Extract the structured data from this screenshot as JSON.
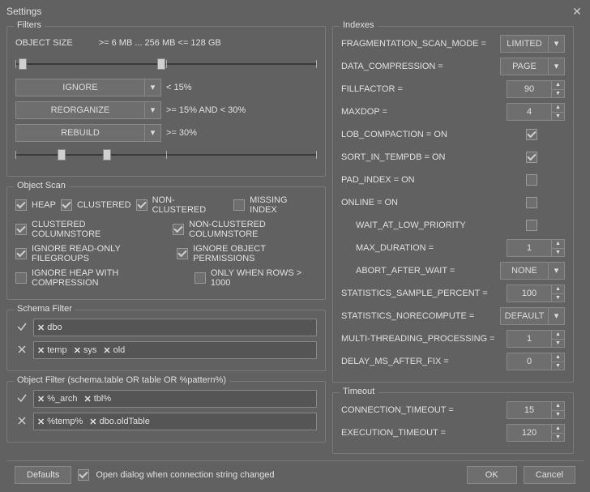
{
  "window": {
    "title": "Settings"
  },
  "filters": {
    "title": "Filters",
    "object_size_label": "OBJECT SIZE",
    "object_size_range": ">= 6 MB ... 256 MB <= 128 GB",
    "action1": {
      "value": "IGNORE",
      "desc": "< 15%"
    },
    "action2": {
      "value": "REORGANIZE",
      "desc": ">= 15% AND < 30%"
    },
    "action3": {
      "value": "REBUILD",
      "desc": ">= 30%"
    }
  },
  "objectscan": {
    "title": "Object Scan",
    "heap": "HEAP",
    "clustered": "CLUSTERED",
    "nonclustered": "NON-CLUSTERED",
    "missing": "MISSING INDEX",
    "clcs": "CLUSTERED COLUMNSTORE",
    "nccs": "NON-CLUSTERED COLUMNSTORE",
    "ignorero": "IGNORE READ-ONLY FILEGROUPS",
    "ignoreperm": "IGNORE OBJECT PERMISSIONS",
    "ignoreheap": "IGNORE HEAP WITH COMPRESSION",
    "onlyrows": "ONLY WHEN ROWS > 1000"
  },
  "schemafilter": {
    "title": "Schema Filter",
    "include": [
      "dbo"
    ],
    "exclude": [
      "temp",
      "sys",
      "old"
    ]
  },
  "objectfilter": {
    "title": "Object Filter (schema.table OR table OR %pattern%)",
    "include": [
      "%_arch",
      "tbl%"
    ],
    "exclude": [
      "%temp%",
      "dbo.oldTable"
    ]
  },
  "indexes": {
    "title": "Indexes",
    "frag_mode": {
      "label": "FRAGMENTATION_SCAN_MODE =",
      "value": "LIMITED"
    },
    "data_comp": {
      "label": "DATA_COMPRESSION =",
      "value": "PAGE"
    },
    "fillfactor": {
      "label": "FILLFACTOR =",
      "value": "90"
    },
    "maxdop": {
      "label": "MAXDOP =",
      "value": "4"
    },
    "lob": {
      "label": "LOB_COMPACTION = ON"
    },
    "sorttemp": {
      "label": "SORT_IN_TEMPDB = ON"
    },
    "padindex": {
      "label": "PAD_INDEX = ON"
    },
    "online": {
      "label": "ONLINE = ON"
    },
    "wait": {
      "label": "WAIT_AT_LOW_PRIORITY"
    },
    "maxdur": {
      "label": "MAX_DURATION =",
      "value": "1"
    },
    "abort": {
      "label": "ABORT_AFTER_WAIT =",
      "value": "NONE"
    },
    "statssample": {
      "label": "STATISTICS_SAMPLE_PERCENT =",
      "value": "100"
    },
    "statsnoreco": {
      "label": "STATISTICS_NORECOMPUTE =",
      "value": "DEFAULT"
    },
    "mtp": {
      "label": "MULTI-THREADING_PROCESSING =",
      "value": "1"
    },
    "delay": {
      "label": "DELAY_MS_AFTER_FIX =",
      "value": "0"
    }
  },
  "timeout": {
    "title": "Timeout",
    "conn": {
      "label": "CONNECTION_TIMEOUT =",
      "value": "15"
    },
    "exec": {
      "label": "EXECUTION_TIMEOUT =",
      "value": "120"
    }
  },
  "footer": {
    "defaults": "Defaults",
    "open_dialog": "Open dialog when connection string changed",
    "ok": "OK",
    "cancel": "Cancel"
  }
}
